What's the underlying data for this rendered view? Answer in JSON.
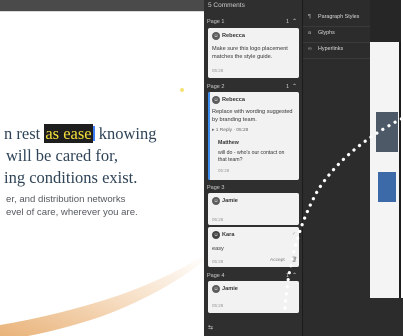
{
  "document": {
    "headline_line1_pre": "n rest ",
    "headline_line1_highlight": "as ease",
    "headline_line1_post": " knowing",
    "headline_line2": "will be cared for,",
    "headline_line3": "ing conditions exist.",
    "body_line1": "er, and distribution networks",
    "body_line2": "evel of care, wherever you are."
  },
  "comments_panel": {
    "title": "5 Comments",
    "groups": [
      {
        "label": "Page 1",
        "count": "1",
        "comments": [
          {
            "author": "Rebecca",
            "text": "Make sure this logo placement matches the style guide.",
            "time": "05:28"
          }
        ]
      },
      {
        "label": "Page 2",
        "count": "1",
        "comments": [
          {
            "author": "Rebecca",
            "text": "Replace with wording suggested by branding team.",
            "reply_summary": "1 Reply · 05:28",
            "reply": {
              "author": "Matthew",
              "text": "will do - who's our contact on that team?",
              "time": "05:28"
            }
          }
        ]
      },
      {
        "label": "Page 3",
        "count": "",
        "comments": [
          {
            "author": "Jamie",
            "time": "05:28"
          },
          {
            "author": "Kara",
            "text": "easy",
            "time": "05:28",
            "action": "Accept"
          }
        ]
      },
      {
        "label": "Page 4",
        "count": "1",
        "comments": [
          {
            "author": "Jamie",
            "time": "05:28"
          }
        ]
      }
    ]
  },
  "side_panel": {
    "items": [
      {
        "label": "Paragraph Styles",
        "icon": "paragraph-styles-icon"
      },
      {
        "label": "Glyphs",
        "icon": "glyphs-icon"
      },
      {
        "label": "Hyperlinks",
        "icon": "hyperlinks-icon"
      }
    ]
  },
  "colors": {
    "highlight_bg": "#1e1e1e",
    "highlight_text": "#f6e03a",
    "headline": "#2f4457",
    "panel_bg": "#2f2f2f",
    "accent": "#3d8cf0"
  }
}
